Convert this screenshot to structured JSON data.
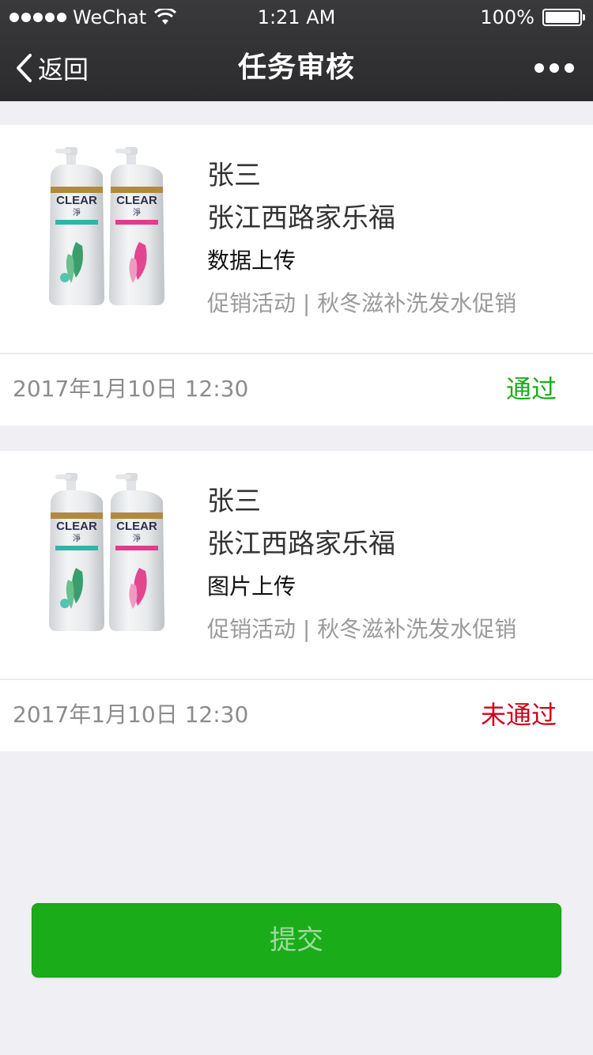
{
  "status_bar": {
    "carrier": "WeChat",
    "time": "1:21 AM",
    "battery": "100%"
  },
  "nav": {
    "back_label": "返回",
    "title": "任务审核",
    "more_icon": "more-dots-icon"
  },
  "tasks": [
    {
      "name": "张三",
      "store": "张江西路家乐福",
      "type": "数据上传",
      "description": "促销活动 | 秋冬滋补洗发水促销",
      "datetime": "2017年1月10日 12:30",
      "status": "通过",
      "status_color": "#1aad19"
    },
    {
      "name": "张三",
      "store": "张江西路家乐福",
      "type": "图片上传",
      "description": "促销活动 | 秋冬滋补洗发水促销",
      "datetime": "2017年1月10日 12:30",
      "status": "未通过",
      "status_color": "#d0021b"
    }
  ],
  "submit_label": "提交",
  "colors": {
    "accent": "#1aad19",
    "reject": "#d0021b",
    "navbar": "#2e2e30",
    "background": "#efeff4"
  }
}
